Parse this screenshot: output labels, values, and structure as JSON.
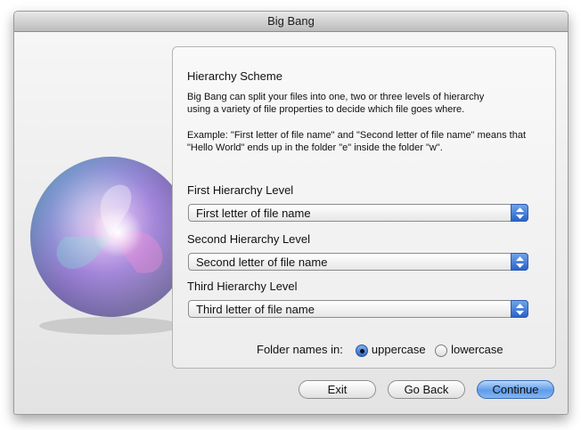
{
  "window": {
    "title": "Big Bang"
  },
  "panel": {
    "heading": "Hierarchy Scheme",
    "description": "Big Bang can split your files into one, two or three levels of hierarchy\nusing a variety of file properties to decide which file goes where.",
    "example": "Example: \"First letter of file name\" and \"Second letter of file name\" means that \"Hello World\" ends up in the folder \"e\" inside the folder \"w\".",
    "levels": [
      {
        "label": "First Hierarchy Level",
        "selected": "First letter of file name"
      },
      {
        "label": "Second Hierarchy Level",
        "selected": "Second letter of file name"
      },
      {
        "label": "Third Hierarchy Level",
        "selected": "Third letter of file name"
      }
    ],
    "folder_names": {
      "label": "Folder names in:",
      "options": [
        "uppercase",
        "lowercase"
      ],
      "selected": "uppercase"
    }
  },
  "buttons": {
    "exit": "Exit",
    "back": "Go Back",
    "continue": "Continue"
  },
  "colors": {
    "accent": "#3b74d6",
    "window_bg": "#ececec"
  }
}
